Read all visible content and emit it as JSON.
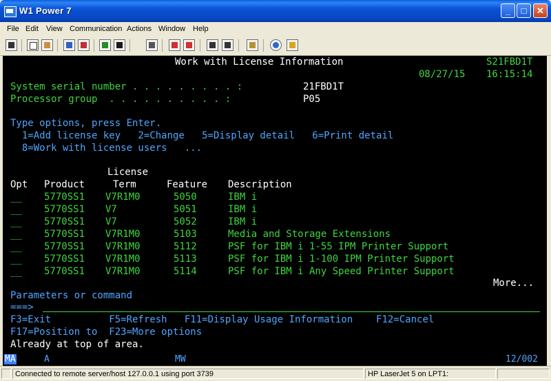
{
  "window": {
    "title": "W1   Power 7",
    "buttons": [
      "_",
      "□",
      "✕"
    ]
  },
  "menu": [
    "File",
    "Edit",
    "View",
    "Communication",
    "Actions",
    "Window",
    "Help"
  ],
  "toolbar": {
    "icons": [
      "print-icon",
      "copy-icon",
      "paste-icon",
      "send-icon",
      "receive-icon",
      "macro-record-icon",
      "macro-play-icon",
      "keyboard-icon",
      "color-icon",
      "data-transfer-up-icon",
      "data-transfer-down-icon",
      "session-up-icon",
      "session-down-icon",
      "clipboard-icon",
      "globe-icon",
      "ticket-icon"
    ]
  },
  "screen": {
    "title": "Work with License Information",
    "system_name": "S21FBD1T",
    "date": "08/27/15",
    "time": "16:15:14",
    "serial_label": "System serial number . . . . . . . . . :",
    "serial_value": "21FBD1T",
    "processor_label": "Processor group  . . . . . . . . . . :",
    "processor_value": "P05",
    "instructions": "Type options, press Enter.",
    "options_line1": "  1=Add license key   2=Change   5=Display detail   6=Print detail",
    "options_line2": "  8=Work with license users   ...",
    "col_header_top": "License",
    "col_headers": {
      "opt": "Opt",
      "product": "Product",
      "term": "Term",
      "feature": "Feature",
      "description": "Description"
    },
    "rows": [
      {
        "opt": "__",
        "product": "5770SS1",
        "term": "V7R1M0",
        "feature": "5050",
        "description": "IBM i"
      },
      {
        "opt": "__",
        "product": "5770SS1",
        "term": "V7",
        "feature": "5051",
        "description": "IBM i"
      },
      {
        "opt": "__",
        "product": "5770SS1",
        "term": "V7",
        "feature": "5052",
        "description": "IBM i"
      },
      {
        "opt": "__",
        "product": "5770SS1",
        "term": "V7R1M0",
        "feature": "5103",
        "description": "Media and Storage Extensions"
      },
      {
        "opt": "__",
        "product": "5770SS1",
        "term": "V7R1M0",
        "feature": "5112",
        "description": "PSF for IBM i 1-55 IPM Printer Support"
      },
      {
        "opt": "__",
        "product": "5770SS1",
        "term": "V7R1M0",
        "feature": "5113",
        "description": "PSF for IBM i 1-100 IPM Printer Support"
      },
      {
        "opt": "__",
        "product": "5770SS1",
        "term": "V7R1M0",
        "feature": "5114",
        "description": "PSF for IBM i Any Speed Printer Support"
      }
    ],
    "more": "More...",
    "params_label": "Parameters or command",
    "prompt": "===>",
    "fkeys_line1": "F3=Exit          F5=Refresh   F11=Display Usage Information    F12=Cancel",
    "fkeys_line2": "F17=Position to  F23=More options",
    "message": "Already at top of area."
  },
  "oia": {
    "ma": "MA",
    "a": "A",
    "mw": "MW",
    "cursor": "12/002"
  },
  "status": {
    "connection": "Connected to remote server/host 127.0.0.1 using port 3739",
    "printer": "HP LaserJet 5 on LPT1:"
  },
  "colors": {
    "green": "#3ed63e",
    "white": "#ffffff",
    "blue": "#4fa6ff",
    "titlebar": "#0a52d6"
  }
}
